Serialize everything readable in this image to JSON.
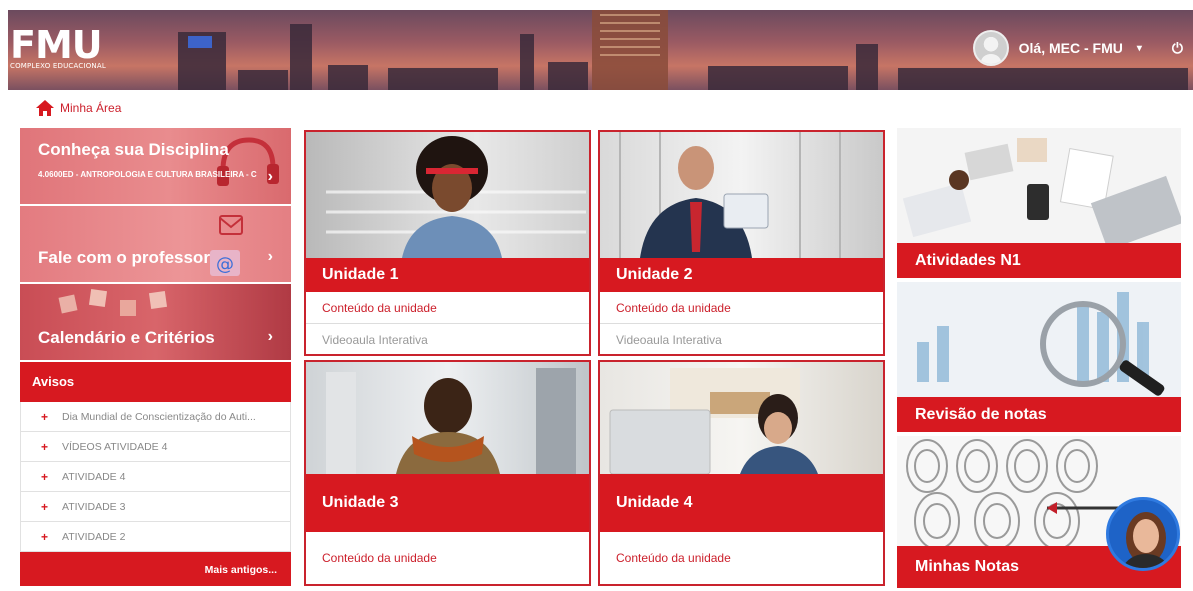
{
  "header": {
    "logo": "FMU",
    "logo_sub": "COMPLEXO EDUCACIONAL",
    "greeting": "Olá, MEC - FMU",
    "caret": "▾",
    "power": "⏻"
  },
  "breadcrumb": {
    "label": "Minha Área"
  },
  "left": {
    "disciplina": {
      "title": "Conheça sua Disciplina",
      "subtitle": "4.0600ED - ANTROPOLOGIA E CULTURA BRASILEIRA - C"
    },
    "professor": {
      "title": "Fale com o professor"
    },
    "calendario": {
      "title": "Calendário e Critérios"
    },
    "chevron": "›",
    "avisos": {
      "title": "Avisos",
      "items": [
        "Dia Mundial de Conscientização do Auti...",
        "VÍDEOS ATIVIDADE 4",
        "ATIVIDADE 4",
        "ATIVIDADE 3",
        "ATIVIDADE 2"
      ],
      "more": "Mais antigos..."
    }
  },
  "units": [
    {
      "title": "Unidade 1",
      "links": [
        "Conteúdo da unidade",
        "Videoaula Interativa"
      ]
    },
    {
      "title": "Unidade 2",
      "links": [
        "Conteúdo da unidade",
        "Videoaula Interativa"
      ]
    },
    {
      "title": "Unidade 3",
      "links": [
        "Conteúdo da unidade"
      ]
    },
    {
      "title": "Unidade 4",
      "links": [
        "Conteúdo da unidade"
      ]
    }
  ],
  "right": {
    "atividades": "Atividades N1",
    "revisao": "Revisão de notas",
    "notas": "Minhas Notas"
  },
  "colors": {
    "brand_red": "#d71920",
    "border_red": "#c9232d"
  }
}
